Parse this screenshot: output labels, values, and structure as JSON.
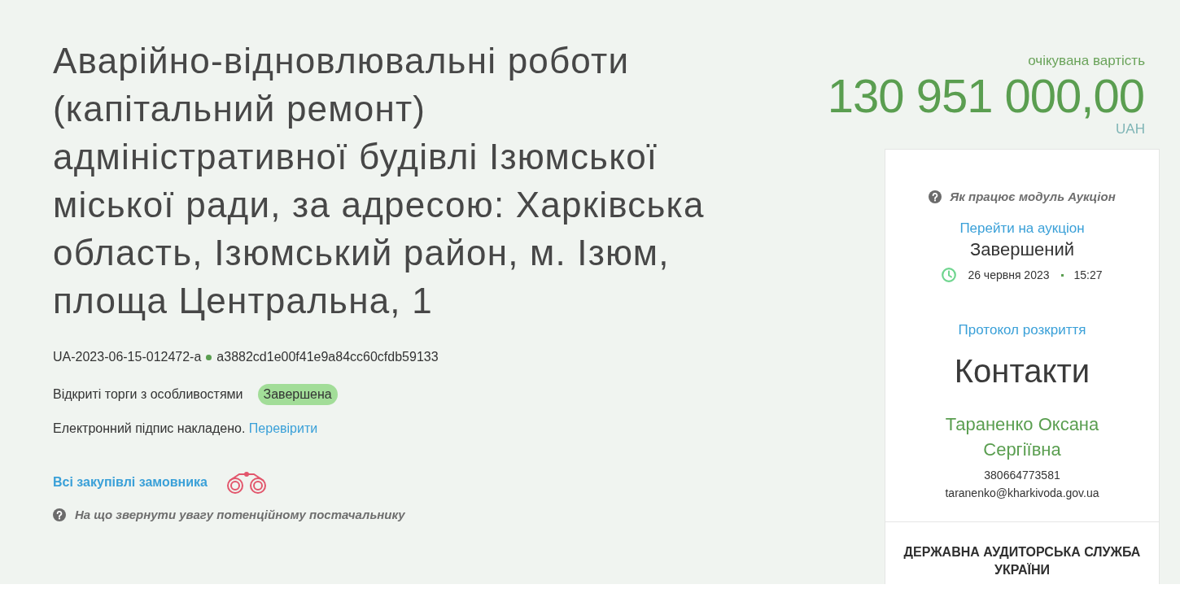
{
  "tender": {
    "title": "Аварійно-відновлювальні роботи (капітальний ремонт) адміністративної будівлі Ізюмської міської ради, за адресою: Харківська область, Ізюмський район, м. Ізюм, площа Центральна, 1",
    "id": "UA-2023-06-15-012472-a",
    "hash": "a3882cd1e00f41e9a84cc60cfdb59133",
    "procedure_type": "Відкриті торги з особливостями",
    "status_badge": "Завершена",
    "signature_text": "Електронний підпис накладено.",
    "signature_link": "Перевірити",
    "buyer_link": "Всі закупівлі замовника",
    "hint": "На що звернути увагу потенційному постачальнику"
  },
  "value": {
    "label": "очікувана вартість",
    "amount": "130 951 000,00",
    "currency": "UAH"
  },
  "auction": {
    "help": "Як працює модуль Аукціон",
    "link": "Перейти на аукціон",
    "status": "Завершений",
    "date": "26 червня 2023",
    "time": "15:27"
  },
  "protocol_link": "Протокол розкриття",
  "contacts": {
    "heading": "Контакти",
    "name": "Тараненко Оксана Сергіївна",
    "phone": "380664773581",
    "email": "taranenko@kharkivoda.gov.ua"
  },
  "monitoring": {
    "heading": "ДЕРЖАВНА АУДИТОРСЬКА СЛУЖБА УКРАЇНИ"
  }
}
